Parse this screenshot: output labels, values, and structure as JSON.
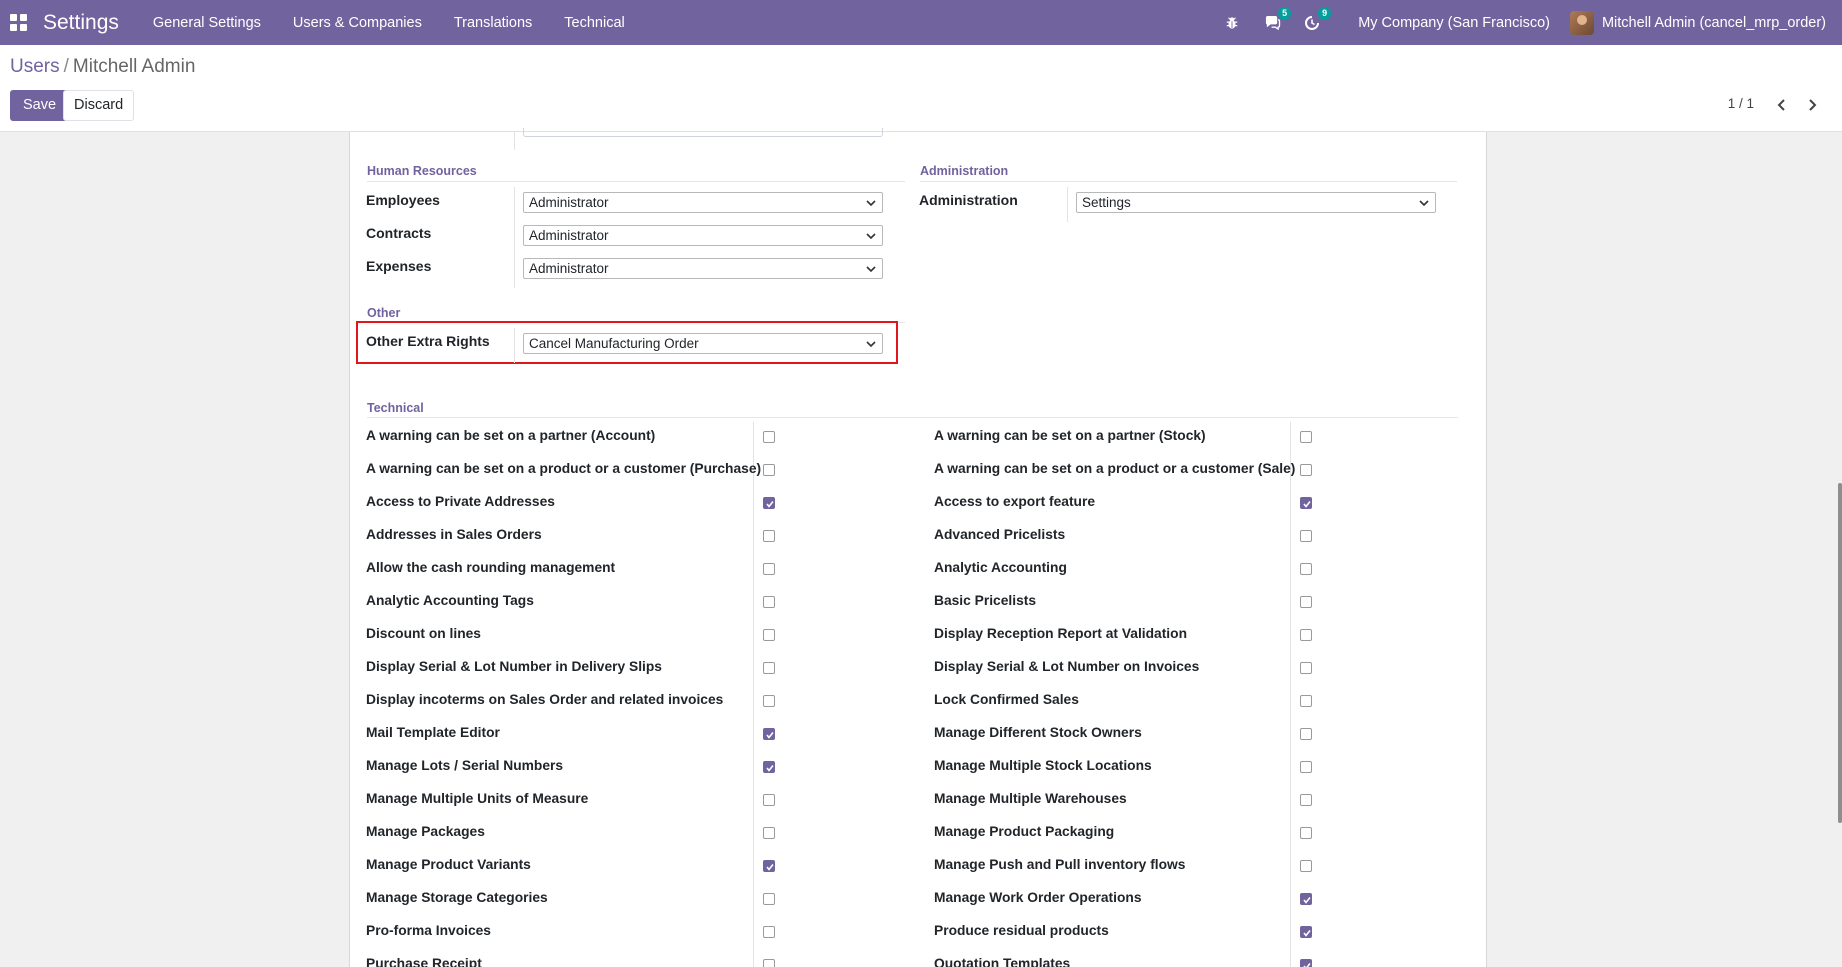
{
  "navbar": {
    "app_title": "Settings",
    "menu": [
      "General Settings",
      "Users & Companies",
      "Translations",
      "Technical"
    ],
    "messages_count": "5",
    "activities_count": "9",
    "company": "My Company (San Francisco)",
    "user": "Mitchell Admin (cancel_mrp_order)",
    "colors": {
      "navbar_bg": "#71639e",
      "badge": "#00a09d"
    }
  },
  "breadcrumb": {
    "parent": "Users",
    "separator": "/",
    "current": "Mitchell Admin"
  },
  "buttons": {
    "save": "Save",
    "discard": "Discard"
  },
  "pager": {
    "value": "1 / 1"
  },
  "form": {
    "human_resources": {
      "title": "Human Resources",
      "fields": [
        {
          "label": "Employees",
          "value": "Administrator"
        },
        {
          "label": "Contracts",
          "value": "Administrator"
        },
        {
          "label": "Expenses",
          "value": "Administrator"
        }
      ]
    },
    "administration": {
      "title": "Administration",
      "fields": [
        {
          "label": "Administration",
          "value": "Settings"
        }
      ]
    },
    "other": {
      "title": "Other",
      "fields": [
        {
          "label": "Other Extra Rights",
          "value": "Cancel Manufacturing Order"
        }
      ]
    },
    "technical": {
      "title": "Technical",
      "left": [
        {
          "label": "A warning can be set on a partner (Account)",
          "checked": false
        },
        {
          "label": "A warning can be set on a product or a customer (Purchase)",
          "checked": false
        },
        {
          "label": "Access to Private Addresses",
          "checked": true
        },
        {
          "label": "Addresses in Sales Orders",
          "checked": false
        },
        {
          "label": "Allow the cash rounding management",
          "checked": false
        },
        {
          "label": "Analytic Accounting Tags",
          "checked": false
        },
        {
          "label": "Discount on lines",
          "checked": false
        },
        {
          "label": "Display Serial & Lot Number in Delivery Slips",
          "checked": false
        },
        {
          "label": "Display incoterms on Sales Order and related invoices",
          "checked": false
        },
        {
          "label": "Mail Template Editor",
          "checked": true
        },
        {
          "label": "Manage Lots / Serial Numbers",
          "checked": true
        },
        {
          "label": "Manage Multiple Units of Measure",
          "checked": false
        },
        {
          "label": "Manage Packages",
          "checked": false
        },
        {
          "label": "Manage Product Variants",
          "checked": true
        },
        {
          "label": "Manage Storage Categories",
          "checked": false
        },
        {
          "label": "Pro-forma Invoices",
          "checked": false
        },
        {
          "label": "Purchase Receipt",
          "checked": false
        }
      ],
      "right": [
        {
          "label": "A warning can be set on a partner (Stock)",
          "checked": false
        },
        {
          "label": "A warning can be set on a product or a customer (Sale)",
          "checked": false
        },
        {
          "label": "Access to export feature",
          "checked": true
        },
        {
          "label": "Advanced Pricelists",
          "checked": false
        },
        {
          "label": "Analytic Accounting",
          "checked": false
        },
        {
          "label": "Basic Pricelists",
          "checked": false
        },
        {
          "label": "Display Reception Report at Validation",
          "checked": false
        },
        {
          "label": "Display Serial & Lot Number on Invoices",
          "checked": false
        },
        {
          "label": "Lock Confirmed Sales",
          "checked": false
        },
        {
          "label": "Manage Different Stock Owners",
          "checked": false
        },
        {
          "label": "Manage Multiple Stock Locations",
          "checked": false
        },
        {
          "label": "Manage Multiple Warehouses",
          "checked": false
        },
        {
          "label": "Manage Product Packaging",
          "checked": false
        },
        {
          "label": "Manage Push and Pull inventory flows",
          "checked": false
        },
        {
          "label": "Manage Work Order Operations",
          "checked": true
        },
        {
          "label": "Produce residual products",
          "checked": true
        },
        {
          "label": "Quotation Templates",
          "checked": true
        }
      ]
    }
  }
}
